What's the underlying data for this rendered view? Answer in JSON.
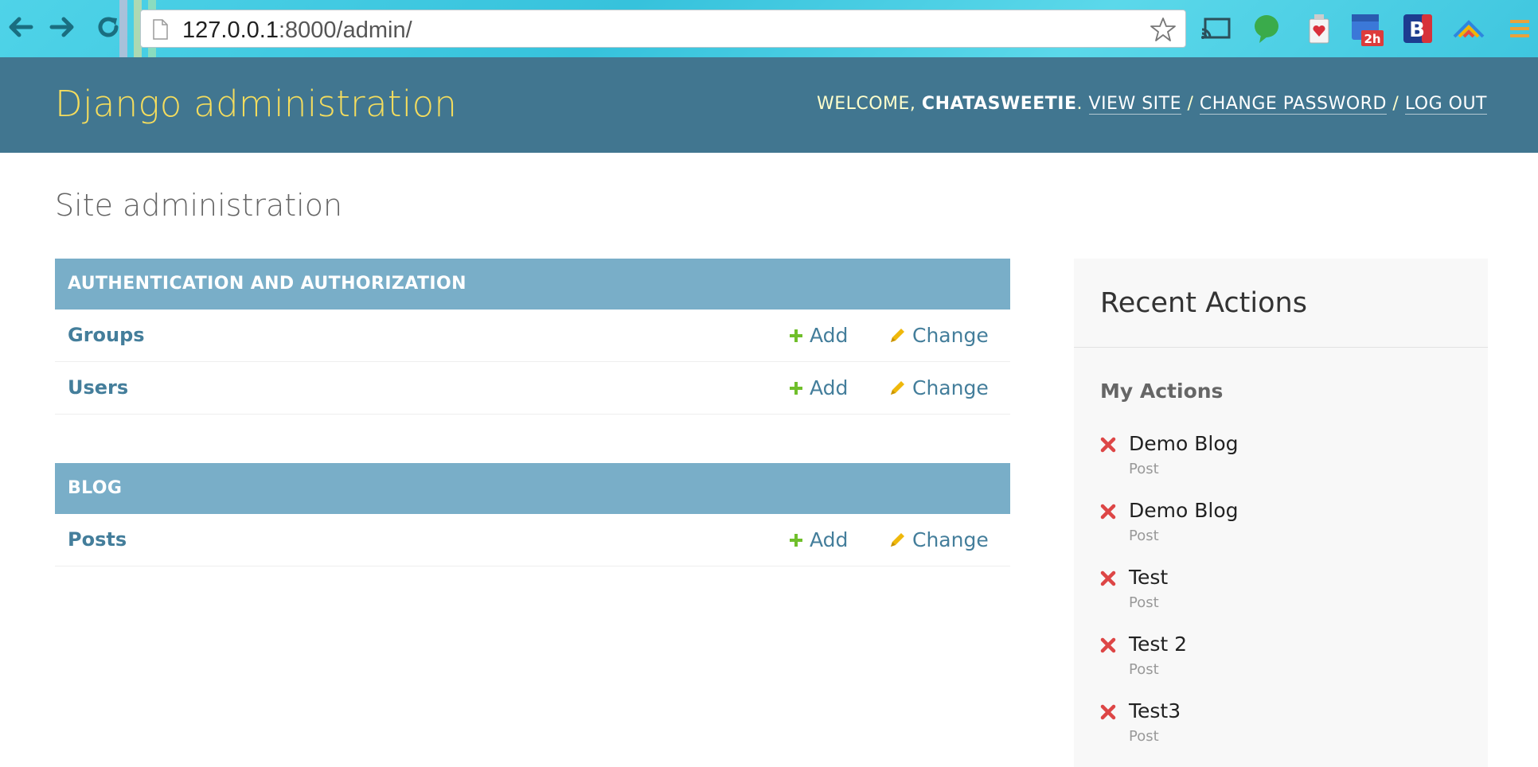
{
  "browser": {
    "url_host": "127.0.0.1",
    "url_path": ":8000/admin/",
    "extension_badge": "2h",
    "extension_letter": "B"
  },
  "header": {
    "site_title": "Django administration",
    "welcome": "WELCOME, ",
    "username": "CHATASWEETIE",
    "welcome_suffix": ". ",
    "view_site": "VIEW SITE",
    "sep1": " / ",
    "change_password": "CHANGE PASSWORD",
    "sep2": " / ",
    "log_out": "LOG OUT"
  },
  "page_title": "Site administration",
  "modules": [
    {
      "caption": "AUTHENTICATION AND AUTHORIZATION",
      "rows": [
        {
          "name": "Groups",
          "add": "Add",
          "change": "Change"
        },
        {
          "name": "Users",
          "add": "Add",
          "change": "Change"
        }
      ]
    },
    {
      "caption": "BLOG",
      "rows": [
        {
          "name": "Posts",
          "add": "Add",
          "change": "Change"
        }
      ]
    }
  ],
  "recent_actions": {
    "title": "Recent Actions",
    "subtitle": "My Actions",
    "items": [
      {
        "name": "Demo Blog",
        "type": "Post"
      },
      {
        "name": "Demo Blog",
        "type": "Post"
      },
      {
        "name": "Test",
        "type": "Post"
      },
      {
        "name": "Test 2",
        "type": "Post"
      },
      {
        "name": "Test3",
        "type": "Post"
      }
    ]
  },
  "colors": {
    "header_bg": "#417690",
    "title_yellow": "#f5dd5d",
    "caption_bg": "#79aec8",
    "link_blue": "#447e9b",
    "add_green": "#70bf2b",
    "change_yellow": "#efb80b",
    "delete_red": "#dd4646"
  },
  "icons": {
    "add": "plus-icon",
    "change": "pencil-icon",
    "delete": "delete-x-icon"
  }
}
